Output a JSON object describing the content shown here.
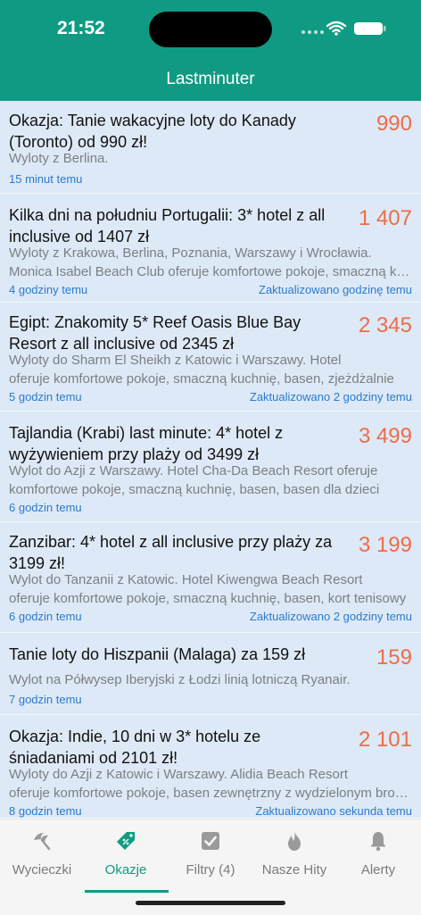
{
  "status_bar": {
    "time": "21:52"
  },
  "app": {
    "title": "Lastminuter"
  },
  "deals": [
    {
      "title": "Okazja: Tanie wakacyjne loty do Kanady (Toronto) od 990 zł!",
      "price": "990",
      "desc_lines": [
        "Wyloty z Berlina."
      ],
      "time": "15 minut temu",
      "updated": ""
    },
    {
      "title": "Kilka dni na południu Portugalii: 3* hotel z all inclusive od 1407 zł",
      "price": "1 407",
      "desc_lines": [
        "Wyloty z Krakowa, Berlina, Poznania, Warszawy i Wrocławia.",
        "Monica Isabel Beach Club oferuje komfortowe pokoje, smaczną kuchnię"
      ],
      "time": "4 godziny temu",
      "updated": "Zaktualizowano godzinę temu"
    },
    {
      "title": "Egipt: Znakomity 5* Reef Oasis Blue Bay Resort z all inclusive od 2345 zł",
      "price": "2 345",
      "desc_lines": [
        "Wyloty do Sharm El Sheikh z Katowic i Warszawy. Hotel",
        "oferuje komfortowe pokoje, smaczną kuchnię, basen, zjeżdżalnie"
      ],
      "time": "5 godzin temu",
      "updated": "Zaktualizowano 2 godziny temu"
    },
    {
      "title": "Tajlandia (Krabi) last minute: 4* hotel z wyżywieniem przy plaży od 3499 zł",
      "price": "3 499",
      "desc_lines": [
        "Wylot do Azji z Warszawy. Hotel Cha-Da Beach Resort oferuje",
        "komfortowe pokoje, smaczną kuchnię, basen, basen dla dzieci"
      ],
      "time": "6 godzin temu",
      "updated": ""
    },
    {
      "title": "Zanzibar: 4* hotel z all inclusive przy plaży za 3199 zł!",
      "price": "3 199",
      "desc_lines": [
        "Wylot do Tanzanii z Katowic. Hotel Kiwengwa Beach Resort",
        "oferuje komfortowe pokoje, smaczną kuchnię, basen, kort tenisowy"
      ],
      "time": "6 godzin temu",
      "updated": "Zaktualizowano 2 godziny temu"
    },
    {
      "title": "Tanie loty do Hiszpanii (Malaga) za 159 zł",
      "price": "159",
      "desc_lines": [
        "Wylot na Półwysep Iberyjski z Łodzi linią lotniczą Ryanair."
      ],
      "time": "7 godzin temu",
      "updated": ""
    },
    {
      "title": "Okazja: Indie, 10 dni w 3* hotelu ze śniadaniami od 2101 zł!",
      "price": "2 101",
      "desc_lines": [
        "Wyloty do Azji z Katowic i Warszawy. Alidia Beach Resort",
        "oferuje komfortowe pokoje, basen zewnętrzny z wydzielonym brodzikiem"
      ],
      "time": "8 godzin temu",
      "updated": "Zaktualizowano sekunda temu"
    }
  ],
  "tabs": [
    {
      "label": "Wycieczki",
      "icon": "beach-umbrella-icon"
    },
    {
      "label": "Okazje",
      "icon": "discount-tag-icon",
      "active": true
    },
    {
      "label": "Filtry (4)",
      "icon": "checkbox-icon"
    },
    {
      "label": "Nasze Hity",
      "icon": "flame-icon"
    },
    {
      "label": "Alerty",
      "icon": "bell-icon"
    }
  ],
  "colors": {
    "accent": "#0f9b83",
    "price": "#ef6c48",
    "link": "#2a7bd0",
    "card_bg": "#dde9f6"
  }
}
